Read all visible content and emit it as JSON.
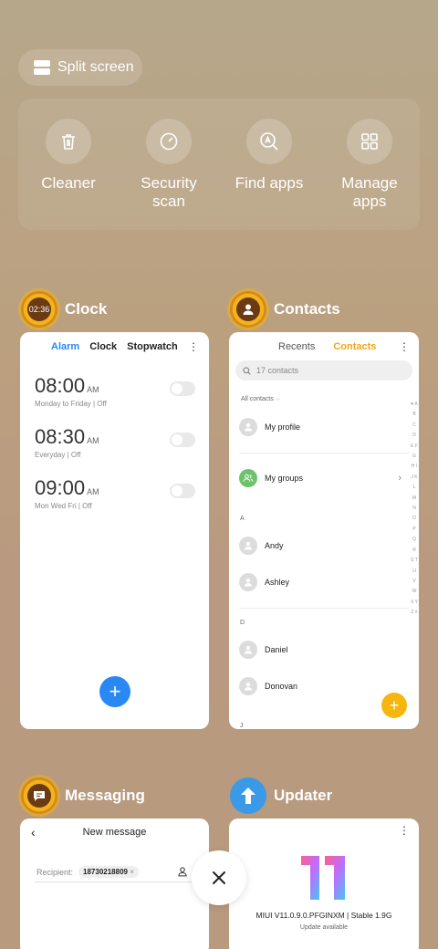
{
  "split_screen": {
    "label": "Split screen"
  },
  "tools": [
    {
      "label": "Cleaner",
      "icon": "trash-icon"
    },
    {
      "label": "Security\nscan",
      "icon": "security-scan-icon"
    },
    {
      "label": "Find apps",
      "icon": "find-apps-icon"
    },
    {
      "label": "Manage\napps",
      "icon": "manage-apps-icon"
    }
  ],
  "clock": {
    "title": "Clock",
    "icon_text": "02:36",
    "tabs": [
      "Alarm",
      "Clock",
      "Stopwatch"
    ],
    "alarms": [
      {
        "time": "08:00",
        "ampm": "AM",
        "repeat": "Monday to Friday | Off"
      },
      {
        "time": "08:30",
        "ampm": "AM",
        "repeat": "Everyday | Off"
      },
      {
        "time": "09:00",
        "ampm": "AM",
        "repeat": "Mon Wed Fri | Off"
      }
    ],
    "fab": "+",
    "accent": "#2a88f5"
  },
  "contacts": {
    "title": "Contacts",
    "tabs": [
      "Recents",
      "Contacts"
    ],
    "search_placeholder": "17 contacts",
    "filter": "All contacts",
    "profile": "My profile",
    "groups": "My groups",
    "section_a": "A",
    "section_d": "D",
    "section_j": "J",
    "names": [
      "Andy",
      "Ashley",
      "Daniel",
      "Donovan"
    ],
    "index": "♥ A B C D E F G H I J K L M N O P Q R S T U V W X Y Z #",
    "fab": "+",
    "accent": "#f2a61a"
  },
  "messaging": {
    "title": "Messaging",
    "header": "New message",
    "recipient_label": "Recipient:",
    "recipient": "18730218809",
    "chip_close": "×"
  },
  "updater": {
    "title": "Updater",
    "version": "MIUI V11.0.9.0.PFGINXM | Stable 1.9G",
    "status": "Update available"
  },
  "close": {
    "icon": "close-icon"
  }
}
